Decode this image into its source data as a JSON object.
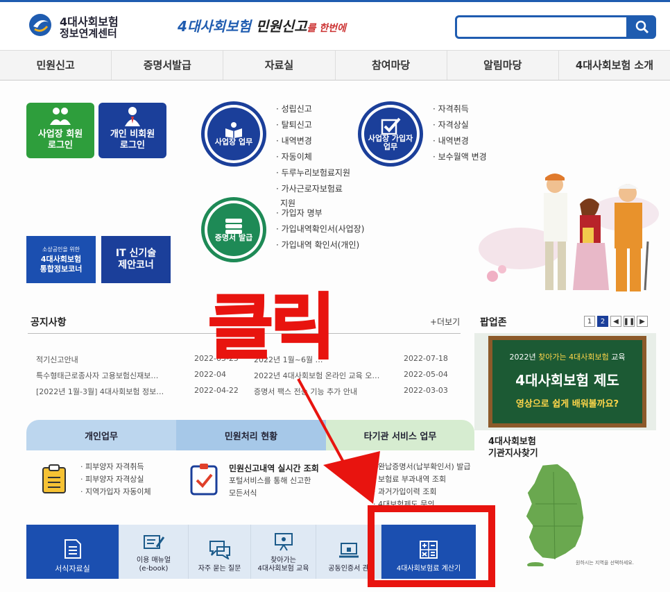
{
  "header": {
    "org_line1": "4대사회보험",
    "org_line2": "정보연계센터",
    "slogan_part1": "4대사회보험",
    "slogan_part2": "민원신고",
    "slogan_part3": "를 한번에",
    "search_placeholder": ""
  },
  "nav": [
    "민원신고",
    "증명서발급",
    "자료실",
    "참여마당",
    "알림마당",
    "4대사회보험 소개"
  ],
  "login": {
    "biz": [
      "사업장 회원",
      "로그인"
    ],
    "personal": [
      "개인 비회원",
      "로그인"
    ]
  },
  "tiles": {
    "small_top": "소상공인을 위한",
    "small_l1": "4대사회보험",
    "small_l2": "통합정보코너",
    "it_l1": "IT 신기술",
    "it_l2": "제안코너"
  },
  "circles": {
    "biz": "사업장 업무",
    "member_l1": "사업장 가입자",
    "member_l2": "업무",
    "cert": "증명서 발급"
  },
  "lists": {
    "biz": [
      "성립신고",
      "탈퇴신고",
      "내역변경",
      "자동이체",
      "두루누리보험료지원",
      "가사근로자보험료",
      "지원"
    ],
    "member": [
      "자격취득",
      "자격상실",
      "내역변경",
      "보수월액 변경"
    ],
    "cert": [
      "가입자 명부",
      "가입내역확인서(사업장)",
      "가입내역 확인서(개인)"
    ]
  },
  "notice": {
    "title": "공지사항",
    "more": "+더보기",
    "rows": [
      {
        "text": "적기신고안내",
        "date": "2022-05-25"
      },
      {
        "text": "특수형태근로종사자 고용보험신재보…",
        "date": "2022-04"
      },
      {
        "text": "[2022년 1월-3월] 4대사회보험 정보…",
        "date": "2022-04-22"
      }
    ],
    "rows_right": [
      {
        "text": "2022년 1월~6월 …",
        "date": "2022-07-18"
      },
      {
        "text": "2022년 4대사회보험 온라인 교육 오…",
        "date": "2022-05-04"
      },
      {
        "text": "증명서 팩스 전송 기능 추가 안내",
        "date": "2022-03-03"
      }
    ]
  },
  "popup": {
    "title": "팝업존",
    "pages": [
      "1",
      "2"
    ],
    "board_l1a": "2022년 ",
    "board_l1b": "찾아가는 4대사회보험",
    "board_l1c": " 교육",
    "board_l2": "4대사회보험 제도",
    "board_l3": "영상으로 쉽게 배워볼까요?"
  },
  "branch": {
    "l1": "4대사회보험",
    "l2": "기관지사찾기",
    "note": "원하시는 지역을 선택하세요."
  },
  "service_tabs": [
    "개인업무",
    "민원처리 현황",
    "타기관 서비스 업무"
  ],
  "service_personal": [
    "피부양자 자격취득",
    "피부양자 자격상실",
    "지역가입자 자동이체"
  ],
  "service_realtime": {
    "title": "민원신고내역 실시간 조회",
    "desc1": "포털서비스를 통해 신고한",
    "desc2": "모든서식"
  },
  "service_other": [
    "완납증명서(납부확인서) 발급",
    "보험료 부과내역 조회",
    "과거가입이력 조회",
    "4대보험제도 문의"
  ],
  "bottom_bar": {
    "forms": "서식자료실",
    "manual_l1": "이용 매뉴얼",
    "manual_l2": "(e-book)",
    "faq": "자주 묻는 질문",
    "edu_l1": "찾아가는",
    "edu_l2": "4대사회보험 교육",
    "cert": "공동인증서 관",
    "calc": "4대사회보험료 계산기"
  },
  "annotation": {
    "click_text": "클릭"
  },
  "colors": {
    "primary": "#1b3f9a",
    "accent_green": "#2e9e3c",
    "annotation_red": "#e8140f"
  }
}
